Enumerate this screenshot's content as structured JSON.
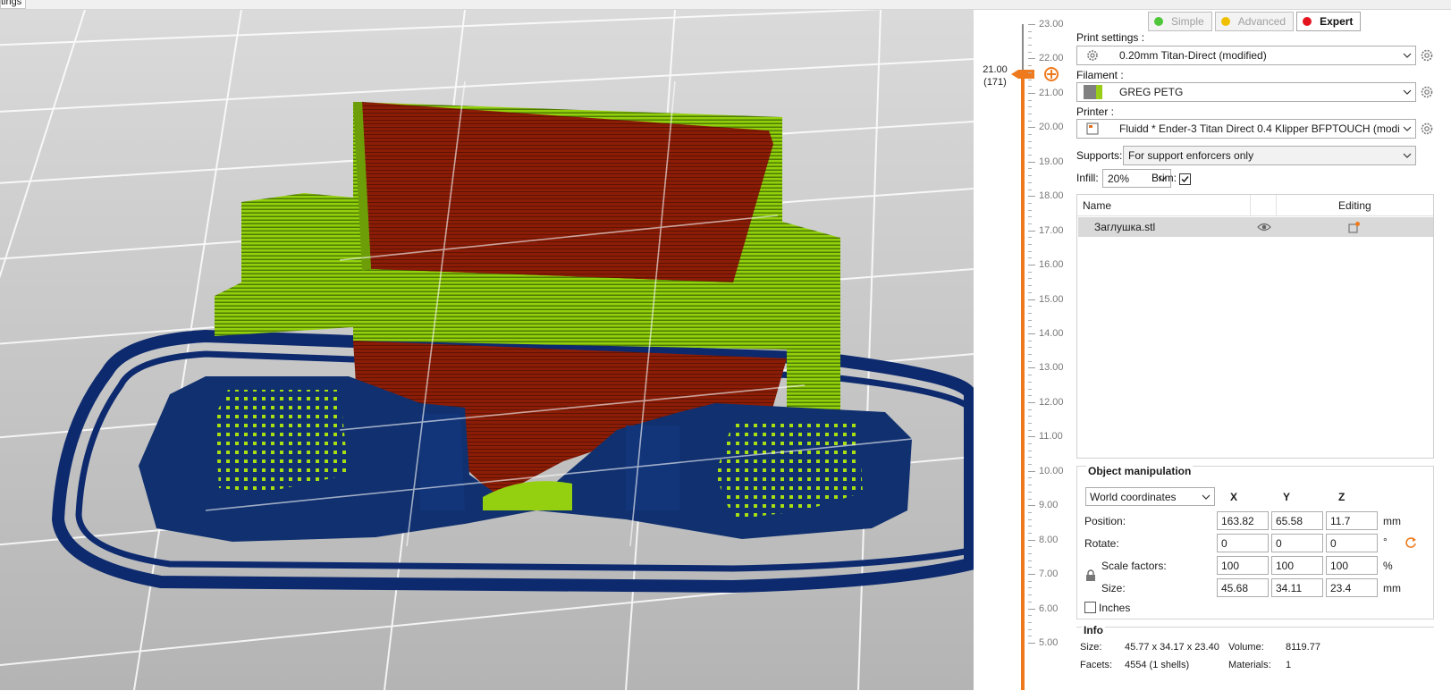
{
  "top_tab": "tings",
  "layer_slider": {
    "current_height": "21.00",
    "current_layer": "(171)",
    "ticks": [
      "23.00",
      "22.00",
      "21.00",
      "20.00",
      "19.00",
      "18.00",
      "17.00",
      "16.00",
      "15.00",
      "14.00",
      "13.00",
      "12.00",
      "11.00",
      "10.00",
      "9.00",
      "8.00",
      "7.00",
      "6.00",
      "5.00"
    ]
  },
  "mode": {
    "simple": "Simple",
    "advanced": "Advanced",
    "expert": "Expert",
    "colors": {
      "simple": "#4fc63a",
      "advanced": "#f0c000",
      "expert": "#e4141e"
    }
  },
  "print_settings": {
    "label": "Print settings :",
    "value": "0.20mm Titan-Direct (modified)"
  },
  "filament": {
    "label": "Filament :",
    "value": "GREG PETG",
    "swatch_colors": [
      "#808080",
      "#9acd1a"
    ]
  },
  "printer": {
    "label": "Printer :",
    "value": "Fluidd * Ender-3 Titan Direct 0.4 Klipper BFPTOUCH (modified)"
  },
  "supports": {
    "label": "Supports:",
    "value": "For support enforcers only"
  },
  "infill": {
    "label": "Infill:",
    "value": "20%"
  },
  "brim": {
    "label": "Brim:",
    "checked": true
  },
  "object_list": {
    "col_name": "Name",
    "col_editing": "Editing",
    "rows": [
      {
        "name": "Заглушка.stl"
      }
    ]
  },
  "object_manipulation": {
    "title": "Object manipulation",
    "coordinate_system": "World coordinates",
    "axes": [
      "X",
      "Y",
      "Z"
    ],
    "position": {
      "label": "Position:",
      "values": [
        "163.82",
        "65.58",
        "11.7"
      ],
      "unit": "mm"
    },
    "rotate": {
      "label": "Rotate:",
      "values": [
        "0",
        "0",
        "0"
      ],
      "unit": "°"
    },
    "scale": {
      "label": "Scale factors:",
      "values": [
        "100",
        "100",
        "100"
      ],
      "unit": "%"
    },
    "size": {
      "label": "Size:",
      "values": [
        "45.68",
        "34.11",
        "23.4"
      ],
      "unit": "mm"
    },
    "inches": {
      "label": "Inches",
      "checked": false
    }
  },
  "info": {
    "title": "Info",
    "size_label": "Size:",
    "size_value": "45.77 x 34.17 x 23.40",
    "volume_label": "Volume:",
    "volume_value": "8119.77",
    "facets_label": "Facets:",
    "facets_value": "4554 (1 shells)",
    "materials_label": "Materials:",
    "materials_value": "1"
  },
  "colors": {
    "accent": "#ee7a1d",
    "perimeter": "#8fcc08",
    "infill": "#8b1a06",
    "brim": "#0d2a6e"
  }
}
